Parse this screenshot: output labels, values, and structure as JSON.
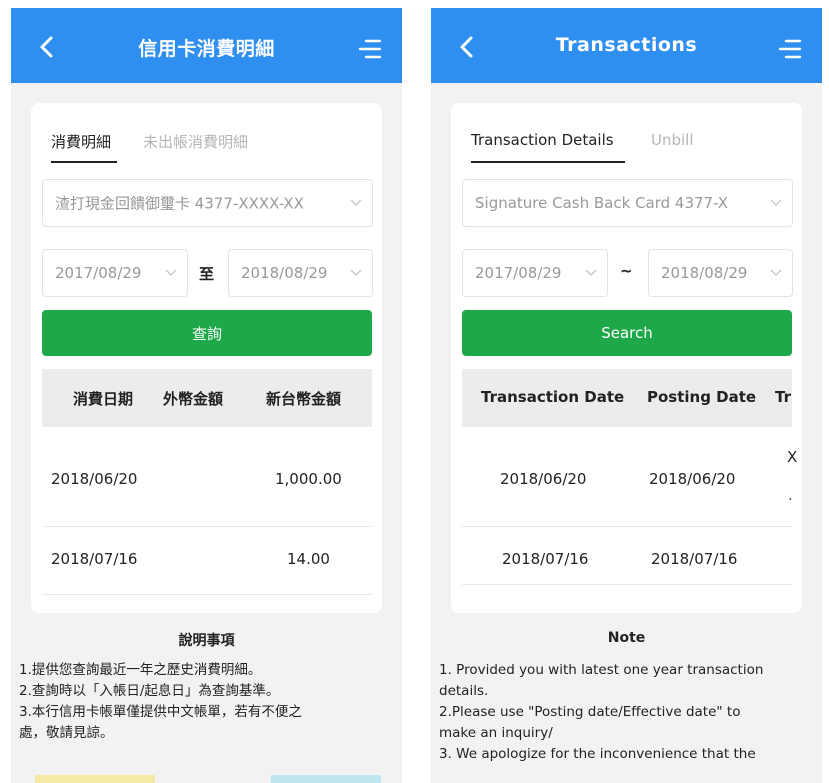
{
  "left": {
    "header": {
      "title": "信用卡消費明細"
    },
    "tabs": [
      "消費明細",
      "未出帳消費明細"
    ],
    "card_select": "渣打現金回饋御璽卡 4377-XXXX-XX",
    "date_from": "2017/08/29",
    "date_separator": "至",
    "date_to": "2018/08/29",
    "search_label": "查詢",
    "table": {
      "headers": [
        "消費日期",
        "外幣金額",
        "新台幣金額"
      ],
      "rows": [
        [
          "2018/06/20",
          "",
          "1,000.00"
        ],
        [
          "2018/07/16",
          "",
          "14.00"
        ]
      ]
    },
    "notes_title": "說明事項",
    "notes": [
      "1.提供您查詢最近一年之歷史消費明細。",
      "2.查詢時以「入帳日/起息日」為查詢基準。",
      "3.本行信用卡帳單僅提供中文帳單，若有不便之",
      "處，敬請見諒。"
    ]
  },
  "right": {
    "header": {
      "title": "Transactions"
    },
    "tabs": [
      "Transaction Details",
      "Unbill"
    ],
    "card_select": "Signature Cash Back Card 4377-X",
    "date_from": "2017/08/29",
    "date_separator": "~",
    "date_to": "2018/08/29",
    "search_label": "Search",
    "table": {
      "headers": [
        "Transaction Date",
        "Posting Date",
        "Tr"
      ],
      "rows": [
        [
          "2018/06/20",
          "2018/06/20",
          "X"
        ],
        [
          "2018/07/16",
          "2018/07/16",
          ""
        ]
      ]
    },
    "notes_title": "Note",
    "notes": [
      "1. Provided you with latest one year transaction",
      "details.",
      "2.Please use \"Posting date/Effective date\" to",
      "make an inquiry/",
      "3. We apologize for the inconvenience that the"
    ]
  },
  "colors": {
    "header_bg": "#2f8ff0",
    "search_bg": "#1fa84a",
    "page_bg": "#f2f2f2"
  },
  "icons": [
    "back-arrow-icon",
    "menu-icon",
    "chevron-down-icon"
  ]
}
